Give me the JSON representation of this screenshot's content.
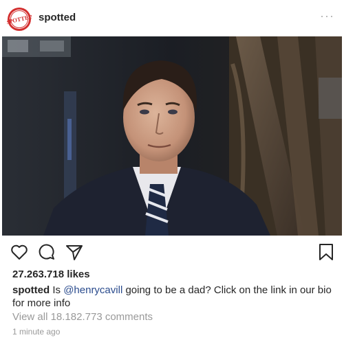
{
  "post": {
    "username": "spotted",
    "avatar_text": "SPOTTED",
    "more_icon": "···",
    "likes": "27.263.718 likes",
    "caption_user": "spotted",
    "caption_pre": " Is ",
    "caption_mention": "@henrycavill",
    "caption_post": " going to be a dad? Click on the link in our bio for more info",
    "view_comments": "View all 18.182.773 comments",
    "time": "1 minute ago"
  },
  "colors": {
    "brand_red": "#d32f2f",
    "mention_blue": "#2a4b8d",
    "muted_gray": "#999999"
  },
  "icons": [
    "heart-icon",
    "comment-icon",
    "share-icon",
    "bookmark-icon",
    "more-icon"
  ]
}
